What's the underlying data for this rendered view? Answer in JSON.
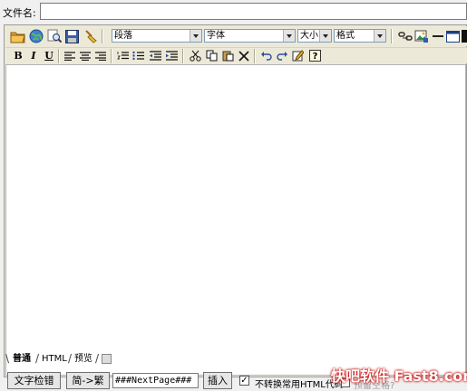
{
  "filename": {
    "label": "文件名:",
    "value": ""
  },
  "toolbar1": {
    "icons": [
      "folder-icon",
      "globe-icon",
      "find-icon",
      "save-icon",
      "clean-icon"
    ],
    "paragraph_select": "段落",
    "font_select": "字体",
    "size_select": "大小",
    "format_select": "格式",
    "right_icons": [
      "link-icon",
      "image-icon",
      "horizontal-rule-icon",
      "table-icon"
    ]
  },
  "toolbar2": {
    "bold": "B",
    "italic": "I",
    "underline": "U"
  },
  "tabs": {
    "normal": "普通",
    "html": "HTML",
    "preview": "预览"
  },
  "bottom": {
    "spellcheck_label": "文字检错",
    "convert_label": "简->繁",
    "nextpage_value": "###NextPage###",
    "insert_label": "插入",
    "no_convert_checkbox_label": "不转换常用HTML代码",
    "no_convert_checked": true,
    "second_checkbox_label": "预留空格?"
  },
  "watermark": "快吧软件 Fast8.com"
}
